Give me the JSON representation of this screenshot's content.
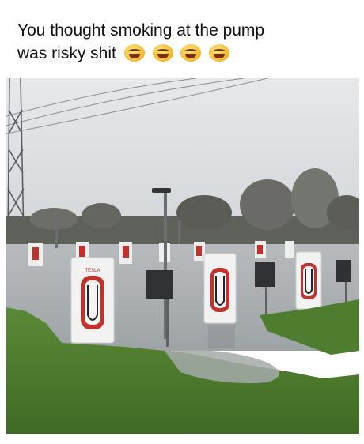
{
  "caption": {
    "line1": "You thought smoking at the pump",
    "line2": "was risky shit",
    "emoji_count": 4,
    "emoji_icon": "laughing-with-tears-emoji"
  },
  "photo": {
    "subject": "Flooded Tesla Supercharger stations",
    "charger_brand_label": "TESLA",
    "colors": {
      "sky": "#d9dde0",
      "water": "#a9aeb0",
      "grass": "#4f7d2f",
      "charger_red": "#c2312b"
    }
  }
}
